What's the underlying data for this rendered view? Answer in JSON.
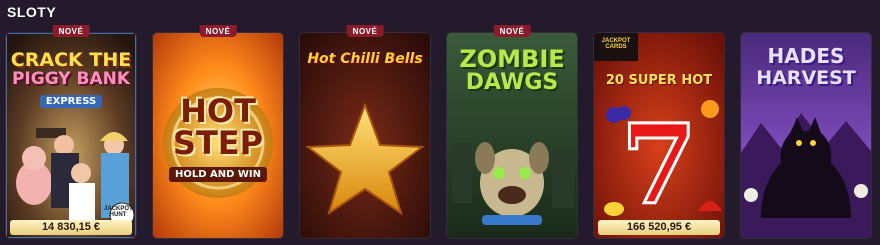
{
  "section": {
    "title": "SLOTY"
  },
  "games": [
    {
      "title_line1": "CRACK THE",
      "title_line2": "PIGGY BANK",
      "title_line3": "EXPRESS",
      "badge": "NOVÉ",
      "jackpot": "14 830,15 €",
      "corner_logo": "JACKPOT HUNT"
    },
    {
      "title_line1": "HOT",
      "title_line2": "STEP",
      "title_line3": "HOLD AND WIN",
      "badge": "NOVÉ"
    },
    {
      "title_line1": "Hot Chilli Bells",
      "badge": "NOVÉ"
    },
    {
      "title_line1": "ZOMBIE",
      "title_line2": "DAWGS",
      "badge": "NOVÉ"
    },
    {
      "title_line1": "20 SUPER HOT",
      "jackpot": "166 520,95 €",
      "corner_logo": "JACKPOT CARDS"
    },
    {
      "title_line1": "HADES",
      "title_line2": "HARVEST"
    }
  ],
  "colors": {
    "badge": "#8b1c2c",
    "jackpot_bg": "#f2dc92",
    "page_bg": "#231a2b"
  }
}
